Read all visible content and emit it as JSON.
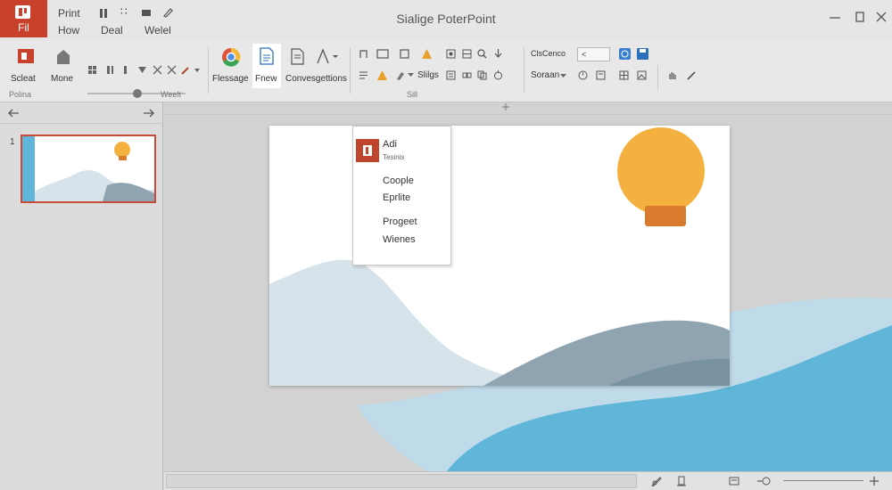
{
  "titlebar": {
    "file_tab": "Fil",
    "menu_top": [
      "Print"
    ],
    "menu_bottom": [
      "How",
      "Deal",
      "Welel"
    ],
    "title": "Sialige PoterPoint"
  },
  "ribbon": {
    "large": [
      {
        "name": "select-button",
        "label": "Scleat"
      },
      {
        "name": "more-button",
        "label": "Mone"
      },
      {
        "name": "message-button",
        "label": "Flessage"
      },
      {
        "name": "new-button",
        "label": "Fnew"
      },
      {
        "name": "conversation-button",
        "label": "Convesgettions"
      }
    ],
    "small_labels": {
      "slides": "Slilgs",
      "screen": "Soraan"
    },
    "combos": {
      "style": "ClsCenco",
      "size": "<"
    },
    "groups": {
      "g1": "Polina",
      "g2": "Weelt",
      "g3": "Sill"
    }
  },
  "dropdown": {
    "header_title": "Adi",
    "header_sub": "Tesinis",
    "items": [
      "Coople",
      "Eprlite",
      "Progeet",
      "Wienes"
    ]
  },
  "thumbnails": [
    {
      "number": "1"
    }
  ],
  "colors": {
    "accent": "#c9412b",
    "sun": "#f4b13f",
    "sun_base": "#d97b2e",
    "wave_light": "#d6e3ea",
    "wave_mid": "#8fa4b0",
    "wave_blue": "#5fb6d8"
  }
}
